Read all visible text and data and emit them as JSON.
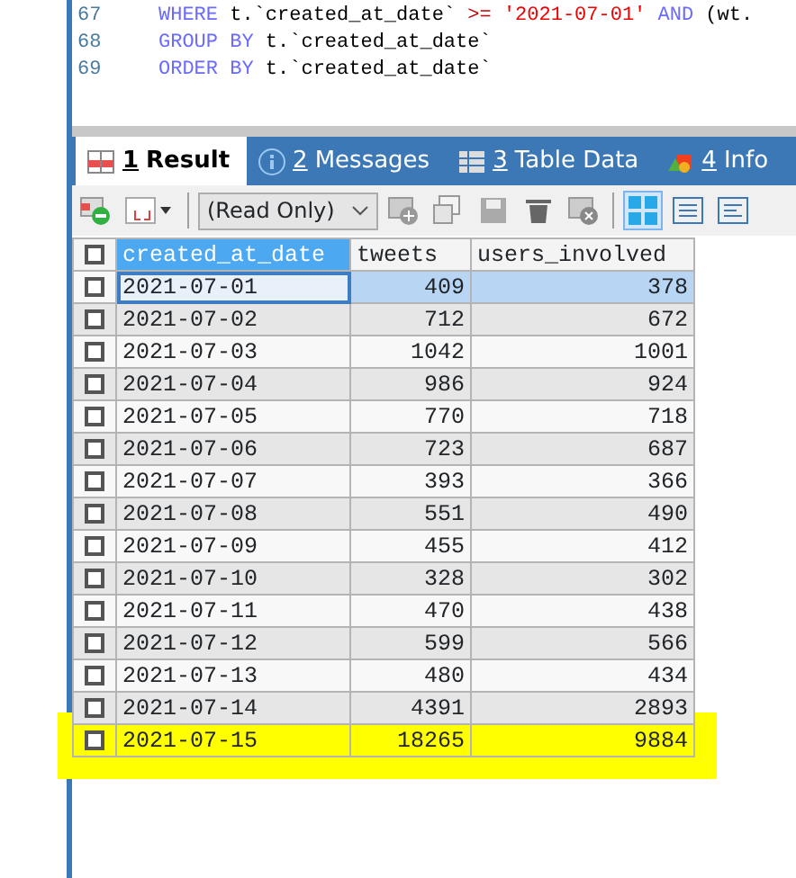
{
  "editor": {
    "lines": [
      {
        "number": "67",
        "segments": [
          {
            "kind": "keyword",
            "text": "WHERE"
          },
          {
            "kind": "plain",
            "text": " t.`created_at_date` "
          },
          {
            "kind": "operator",
            "text": ">="
          },
          {
            "kind": "string",
            "text": " '2021-07-01' "
          },
          {
            "kind": "keyword",
            "text": "AND"
          },
          {
            "kind": "plain",
            "text": " (wt."
          }
        ]
      },
      {
        "number": "68",
        "segments": [
          {
            "kind": "keyword",
            "text": "GROUP BY"
          },
          {
            "kind": "plain",
            "text": " t.`created_at_date`"
          }
        ]
      },
      {
        "number": "69",
        "segments": [
          {
            "kind": "keyword",
            "text": "ORDER BY"
          },
          {
            "kind": "plain",
            "text": " t.`created_at_date`"
          }
        ]
      }
    ]
  },
  "tabs": [
    {
      "number": "1",
      "label": "Result",
      "kind": "result",
      "selected": true
    },
    {
      "number": "2",
      "label": "Messages",
      "kind": "messages",
      "selected": false
    },
    {
      "number": "3",
      "label": "Table Data",
      "kind": "table",
      "selected": false
    },
    {
      "number": "4",
      "label": "Info",
      "kind": "info",
      "selected": false
    }
  ],
  "toolbar": {
    "mode": "(Read Only)",
    "view_modes": [
      {
        "kind": "grid",
        "selected": true
      },
      {
        "kind": "form",
        "selected": false
      },
      {
        "kind": "text",
        "selected": false
      }
    ]
  },
  "table": {
    "all_checked": false,
    "columns": [
      {
        "label": "created_at_date",
        "selected": true
      },
      {
        "label": "tweets",
        "selected": false
      },
      {
        "label": "users_involved",
        "selected": false
      }
    ],
    "rows": [
      {
        "cells": [
          "2021-07-01",
          "409",
          "378"
        ],
        "checked": false,
        "selected": true,
        "highlighted": false
      },
      {
        "cells": [
          "2021-07-02",
          "712",
          "672"
        ],
        "checked": false,
        "selected": false,
        "highlighted": false
      },
      {
        "cells": [
          "2021-07-03",
          "1042",
          "1001"
        ],
        "checked": false,
        "selected": false,
        "highlighted": false
      },
      {
        "cells": [
          "2021-07-04",
          "986",
          "924"
        ],
        "checked": false,
        "selected": false,
        "highlighted": false
      },
      {
        "cells": [
          "2021-07-05",
          "770",
          "718"
        ],
        "checked": false,
        "selected": false,
        "highlighted": false
      },
      {
        "cells": [
          "2021-07-06",
          "723",
          "687"
        ],
        "checked": false,
        "selected": false,
        "highlighted": false
      },
      {
        "cells": [
          "2021-07-07",
          "393",
          "366"
        ],
        "checked": false,
        "selected": false,
        "highlighted": false
      },
      {
        "cells": [
          "2021-07-08",
          "551",
          "490"
        ],
        "checked": false,
        "selected": false,
        "highlighted": false
      },
      {
        "cells": [
          "2021-07-09",
          "455",
          "412"
        ],
        "checked": false,
        "selected": false,
        "highlighted": false
      },
      {
        "cells": [
          "2021-07-10",
          "328",
          "302"
        ],
        "checked": false,
        "selected": false,
        "highlighted": false
      },
      {
        "cells": [
          "2021-07-11",
          "470",
          "438"
        ],
        "checked": false,
        "selected": false,
        "highlighted": false
      },
      {
        "cells": [
          "2021-07-12",
          "599",
          "566"
        ],
        "checked": false,
        "selected": false,
        "highlighted": false
      },
      {
        "cells": [
          "2021-07-13",
          "480",
          "434"
        ],
        "checked": false,
        "selected": false,
        "highlighted": false
      },
      {
        "cells": [
          "2021-07-14",
          "4391",
          "2893"
        ],
        "checked": false,
        "selected": false,
        "highlighted": false
      },
      {
        "cells": [
          "2021-07-15",
          "18265",
          "9884"
        ],
        "checked": false,
        "selected": false,
        "highlighted": true
      }
    ]
  }
}
